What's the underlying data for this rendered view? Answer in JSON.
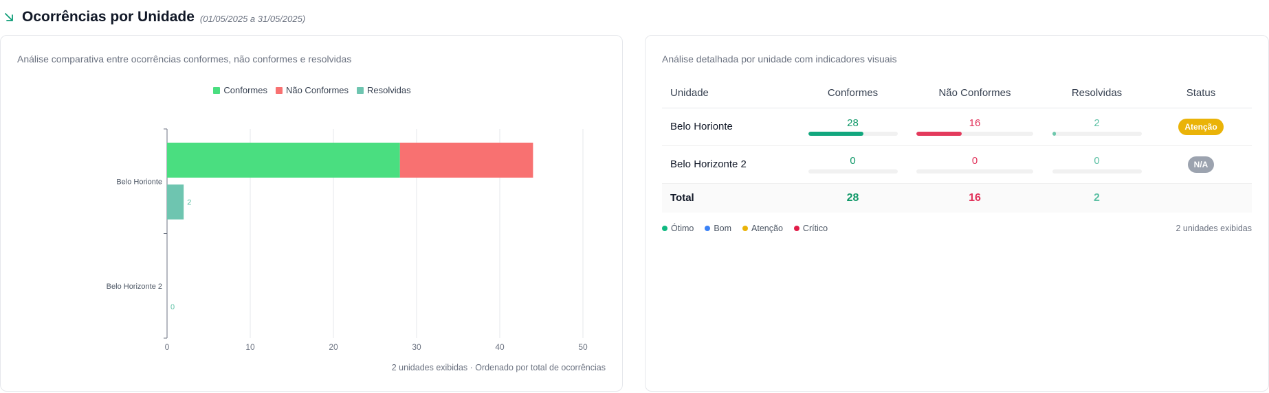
{
  "header": {
    "title": "Ocorrências por Unidade",
    "period": "(01/05/2025 a 31/05/2025)"
  },
  "chart_panel": {
    "description": "Análise comparativa entre ocorrências conformes, não conformes e resolvidas",
    "footer": "2 unidades exibidas · Ordenado por total de ocorrências"
  },
  "chart_data": {
    "type": "bar",
    "orientation": "horizontal",
    "categories": [
      "Belo Horionte",
      "Belo Horizonte 2"
    ],
    "series": [
      {
        "name": "Conformes",
        "values": [
          28,
          0
        ],
        "color": "#4ade80",
        "stack": "a"
      },
      {
        "name": "Não Conformes",
        "values": [
          16,
          0
        ],
        "color": "#f87171",
        "stack": "a"
      },
      {
        "name": "Resolvidas",
        "values": [
          2,
          0
        ],
        "color": "#6ec5b0",
        "stack": "b",
        "labels": [
          "2",
          "0"
        ]
      }
    ],
    "xlim": [
      0,
      50
    ],
    "xticks": [
      "0",
      "10",
      "20",
      "30",
      "40",
      "50"
    ],
    "grid": true,
    "legend_position": "top-center"
  },
  "table_panel": {
    "description": "Análise detalhada por unidade com indicadores visuais",
    "columns": [
      "Unidade",
      "Conformes",
      "Não Conformes",
      "Resolvidas",
      "Status"
    ],
    "rows": [
      {
        "unit": "Belo Horionte",
        "conformes": "28",
        "nao_conformes": "16",
        "resolvidas": "2",
        "status": "Atenção",
        "conformes_fraction": 0.62,
        "nao_conformes_fraction": 0.39,
        "resolvidas_fraction": 0.04
      },
      {
        "unit": "Belo Horizonte 2",
        "conformes": "0",
        "nao_conformes": "0",
        "resolvidas": "0",
        "status": "N/A",
        "conformes_fraction": 0,
        "nao_conformes_fraction": 0,
        "resolvidas_fraction": 0
      }
    ],
    "total": {
      "label": "Total",
      "conformes": "28",
      "nao_conformes": "16",
      "resolvidas": "2"
    },
    "status_legend": [
      {
        "label": "Ótimo",
        "color": "#10b981"
      },
      {
        "label": "Bom",
        "color": "#3b82f6"
      },
      {
        "label": "Atenção",
        "color": "#eab308"
      },
      {
        "label": "Crítico",
        "color": "#e11d48"
      }
    ],
    "units_count": "2 unidades exibidas"
  },
  "icons": {
    "header_icon": "arrow-down-right-icon"
  }
}
